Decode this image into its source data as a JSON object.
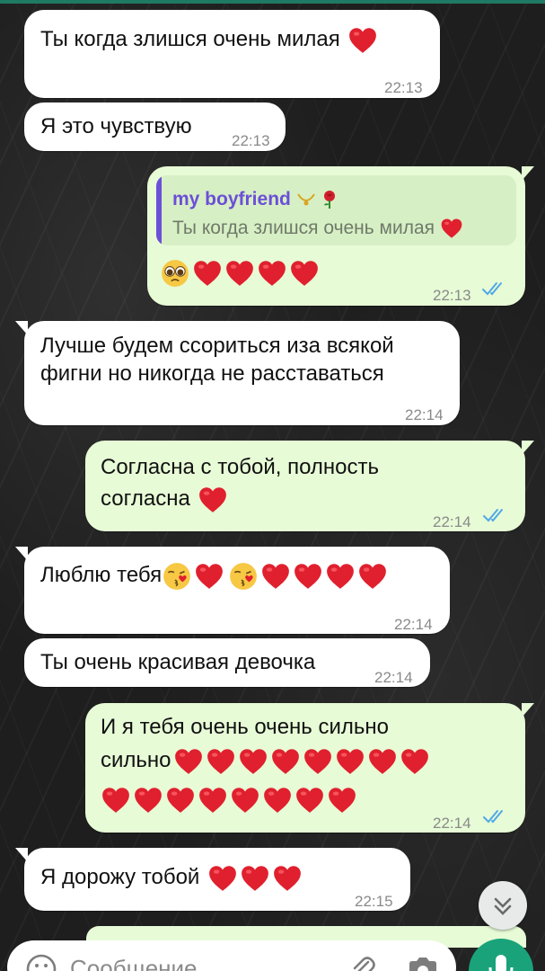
{
  "messages": [
    {
      "text": "Ты когда злишся очень милая",
      "time": "22:13"
    },
    {
      "text": "Я это чувствую",
      "time": "22:13"
    },
    {
      "reply_name": "my boyfriend",
      "reply_text": "Ты когда злишся очень милая",
      "time": "22:13"
    },
    {
      "line1": "Лучше будем ссориться иза всякой",
      "line2": "фигни но никогда не расставаться",
      "time": "22:14"
    },
    {
      "line1": "Согласна с тобой, полность",
      "line2": "согласна",
      "time": "22:14"
    },
    {
      "text": "Люблю тебя",
      "time": "22:14"
    },
    {
      "text": "Ты очень красивая девочка",
      "time": "22:14"
    },
    {
      "line1": "И я тебя очень очень сильно",
      "line2": "сильно",
      "time": "22:14"
    },
    {
      "text": "Я дорожу тобой",
      "time": "22:15"
    }
  ],
  "composer": {
    "placeholder": "Сообщение"
  },
  "colors": {
    "incoming": "#ffffff",
    "outgoing": "#e7fbd6",
    "heart": "#e0202e",
    "read_ticks": "#4fa8e8",
    "accent": "#1aa37a",
    "reply_name": "#6b4fd8"
  },
  "icons": [
    "heart-icon",
    "pleading-face-icon",
    "kissing-face-icon",
    "necklace-icon",
    "rose-icon",
    "double-check-icon",
    "chevron-double-down-icon",
    "emoji-icon",
    "attach-icon",
    "camera-icon",
    "microphone-icon"
  ]
}
